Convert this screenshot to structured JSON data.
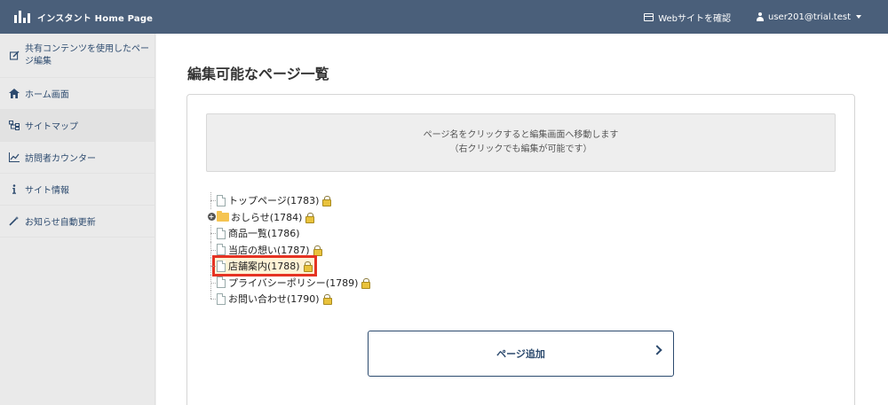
{
  "header": {
    "app_name": "インスタント Home Page",
    "view_site_label": "Webサイトを確認",
    "user_label": "user201@trial.test",
    "bg_color": "#4a5f7a"
  },
  "sidebar": {
    "items": [
      {
        "label": "共有コンテンツを使用したページ編集",
        "icon": "edit-icon"
      },
      {
        "label": "ホーム画面",
        "icon": "home-icon"
      },
      {
        "label": "サイトマップ",
        "icon": "sitemap-icon",
        "active": true
      },
      {
        "label": "訪問者カウンター",
        "icon": "chart-icon"
      },
      {
        "label": "サイト情報",
        "icon": "info-icon"
      },
      {
        "label": "お知らせ自動更新",
        "icon": "magic-wand-icon"
      }
    ]
  },
  "main": {
    "title": "編集可能なページ一覧",
    "notice_line1": "ページ名をクリックすると編集画面へ移動します",
    "notice_line2": "（右クリックでも編集が可能です）",
    "tree": [
      {
        "label": "トップページ(1783)"
      },
      {
        "label": "おしらせ(1784)"
      },
      {
        "label": "商品一覧(1786)"
      },
      {
        "label": "当店の想い(1787)"
      },
      {
        "label": "店舗案内(1788)"
      },
      {
        "label": "プライバシーポリシー(1789)"
      },
      {
        "label": "お問い合わせ(1790)"
      }
    ],
    "add_button_label": "ページ追加",
    "highlight_color": "#e53323"
  }
}
